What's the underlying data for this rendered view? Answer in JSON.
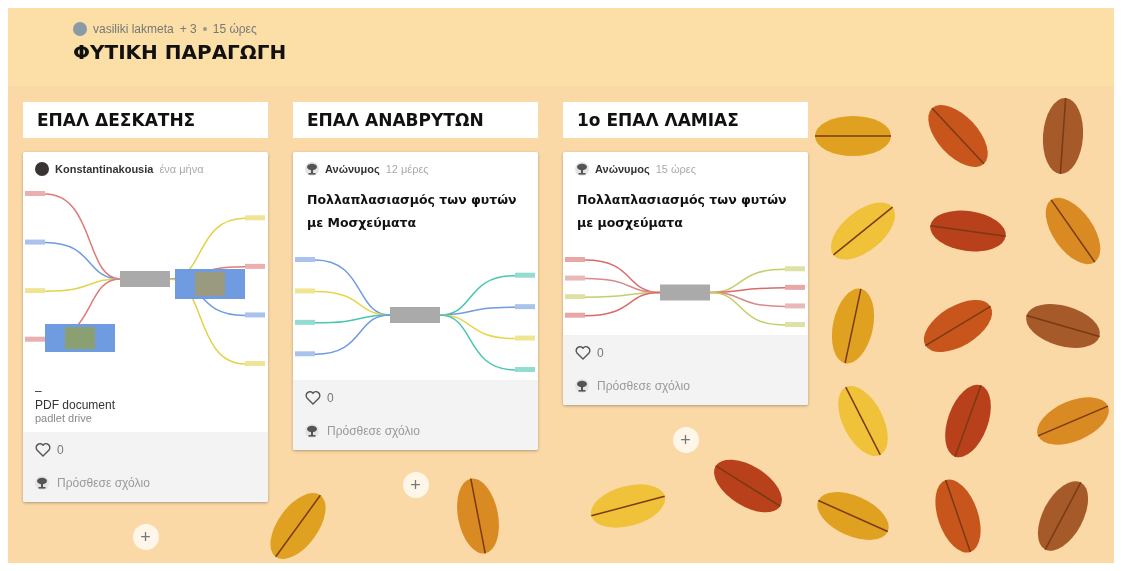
{
  "board": {
    "author": "vasiliki lakmeta",
    "contributors": "+ 3",
    "time": "15 ώρες",
    "title": "ΦΥΤΙΚΗ ΠΑΡΑΓΩΓΗ"
  },
  "columns": [
    {
      "title": "ΕΠΑΛ ΔΕΣΚΑΤΗΣ",
      "add": "+",
      "posts": [
        {
          "author": "Konstantinakousia",
          "avatar": {
            "kind": "photo"
          },
          "time": "ένα μήνα",
          "preview": {
            "kind": "mindmap"
          },
          "file": {
            "title": "–",
            "type": "PDF document",
            "source": "padlet drive"
          },
          "likes": "0",
          "comment_placeholder": "Πρόσθεσε σχόλιο"
        }
      ]
    },
    {
      "title": "ΕΠΑΛ ΑΝΑΒΡΥΤΩΝ",
      "add": "+",
      "posts": [
        {
          "author": "Ανώνυμος",
          "avatar": {
            "kind": "anonymous"
          },
          "time": "12 μέρες",
          "title": "Πολλαπλασιασμός των φυτών με Μοσχεύματα",
          "preview": {
            "kind": "mindmap"
          },
          "likes": "0",
          "comment_placeholder": "Πρόσθεσε σχόλιο"
        }
      ]
    },
    {
      "title": "1ο ΕΠΑΛ ΛΑΜΙΑΣ",
      "add": "+",
      "posts": [
        {
          "author": "Ανώνυμος",
          "avatar": {
            "kind": "anonymous"
          },
          "time": "15 ώρες",
          "title": "Πολλαπλασιασμός των φυτών με μοσχεύματα",
          "preview": {
            "kind": "mindmap"
          },
          "likes": "0",
          "comment_placeholder": "Πρόσθεσε σχόλιο"
        }
      ]
    }
  ]
}
